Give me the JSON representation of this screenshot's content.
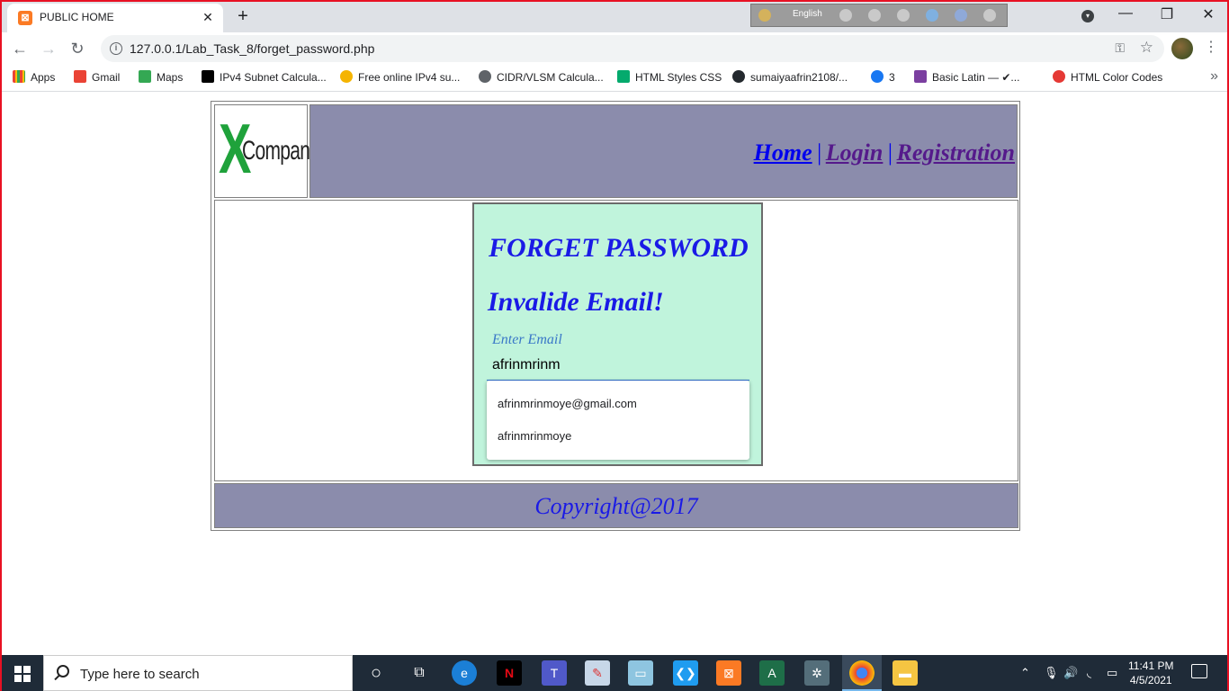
{
  "browser": {
    "tab_title": "PUBLIC HOME",
    "tab_close": "✕",
    "new_tab": "+",
    "url": "127.0.0.1/Lab_Task_8/forget_password.php",
    "language": "English",
    "bookmarks": [
      {
        "label": "Apps",
        "icon": "apps-grid-icon",
        "color": "#4285f4"
      },
      {
        "label": "Gmail",
        "icon": "gmail-icon",
        "color": "#ea4335"
      },
      {
        "label": "Maps",
        "icon": "maps-icon",
        "color": "#34a853"
      },
      {
        "label": "IPv4 Subnet Calcula...",
        "icon": "notion-icon",
        "color": "#000000"
      },
      {
        "label": "Free online IPv4 su...",
        "icon": "amazon-icon",
        "color": "#f5b400"
      },
      {
        "label": "CIDR/VLSM Calcula...",
        "icon": "globe-icon",
        "color": "#5f6368"
      },
      {
        "label": "HTML Styles CSS",
        "icon": "w3schools-icon",
        "color": "#04aa6d"
      },
      {
        "label": "sumaiyaafrin2108/...",
        "icon": "github-icon",
        "color": "#24292e"
      },
      {
        "label": "3",
        "icon": "facebook-icon",
        "color": "#1877f2"
      },
      {
        "label": "Basic Latin — ✔...",
        "icon": "ut-icon",
        "color": "#7b3fa0"
      },
      {
        "label": "HTML Color Codes",
        "icon": "color-codes-icon",
        "color": "#e53935"
      }
    ]
  },
  "site": {
    "logo_x": "X",
    "logo_text": "Company",
    "nav": {
      "home": "Home",
      "login": "Login",
      "registration": "Registration",
      "separator": "|"
    },
    "form": {
      "title": "FORGET PASSWORD",
      "error": "Invalide Email!",
      "email_label": "Enter Email",
      "email_value": "afrinmrinm",
      "suggestions": [
        "afrinmrinmoye@gmail.com",
        "afrinmrinmoye"
      ]
    },
    "footer": "Copyright@2017"
  },
  "taskbar": {
    "search_placeholder": "Type here to search",
    "time": "11:41 PM",
    "date": "4/5/2021"
  },
  "colors": {
    "header_bg": "#8b8cac",
    "form_bg": "#c0f4dc",
    "heading_text": "#1a1ae6",
    "logo_green": "#1fa23b"
  }
}
